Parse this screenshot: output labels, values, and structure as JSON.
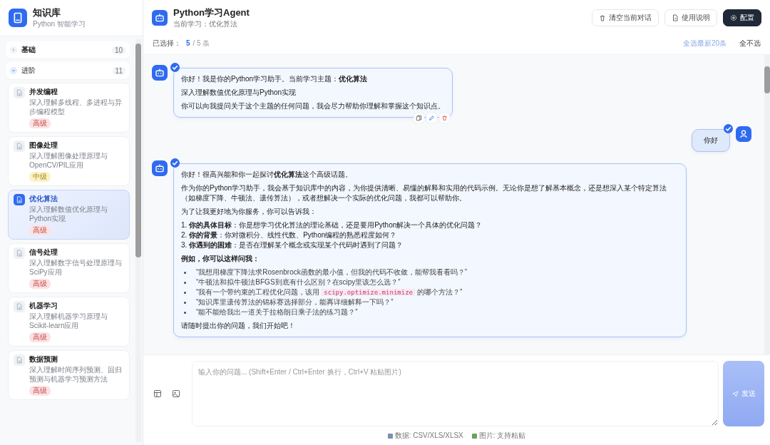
{
  "sidebar": {
    "title": "知识库",
    "subtitle": "Python 智能学习",
    "groups": [
      {
        "label": "基础",
        "count": "10",
        "expanded": false
      },
      {
        "label": "进阶",
        "count": "11",
        "expanded": true,
        "items": [
          {
            "title": "并发编程",
            "desc": "深入理解多线程、多进程与异步编程模型",
            "tag": {
              "label": "高级",
              "kind": "advanced"
            },
            "selected": false
          },
          {
            "title": "图像处理",
            "desc": "深入理解图像处理原理与OpenCV/PIL应用",
            "tag": {
              "label": "中级",
              "kind": "intermediate"
            },
            "selected": false
          },
          {
            "title": "优化算法",
            "desc": "深入理解数值优化原理与Python实现",
            "tag": {
              "label": "高级",
              "kind": "advanced"
            },
            "selected": true
          },
          {
            "title": "信号处理",
            "desc": "深入理解数字信号处理原理与SciPy应用",
            "tag": {
              "label": "高级",
              "kind": "advanced"
            },
            "selected": false
          },
          {
            "title": "机器学习",
            "desc": "深入理解机器学习原理与Scikit-learn应用",
            "tag": {
              "label": "高级",
              "kind": "advanced"
            },
            "selected": false
          },
          {
            "title": "数据预测",
            "desc": "深入理解时间序列预测、回归预测与机器学习预测方法",
            "tag": {
              "label": "高级",
              "kind": "advanced"
            },
            "selected": false
          }
        ]
      }
    ]
  },
  "header": {
    "title": "Python学习Agent",
    "subtitle": "当前学习：优化算法",
    "buttons": [
      {
        "label": "清空当前对话",
        "kind": "clear"
      },
      {
        "label": "使用说明",
        "kind": "help"
      },
      {
        "label": "配置",
        "kind": "config"
      }
    ]
  },
  "selection": {
    "label": "已选择：",
    "count": "5",
    "total": "/ 5 条",
    "select_latest": "全选最新20条",
    "select_none": "全不选"
  },
  "messages": [
    {
      "kind": "bot",
      "checked": true,
      "actions": true,
      "blocks": [
        {
          "kind": "p",
          "text": "你好！我是你的Python学习助手。当前学习主题：**优化算法**"
        },
        {
          "kind": "p",
          "text": "深入理解数值优化原理与Python实现"
        },
        {
          "kind": "p",
          "text": "你可以向我提问关于这个主题的任何问题，我会尽力帮助你理解和掌握这个知识点。"
        }
      ]
    },
    {
      "kind": "user",
      "checked": true,
      "actions": false,
      "blocks": [
        {
          "kind": "p",
          "text": "你好"
        }
      ]
    },
    {
      "kind": "bot",
      "checked": true,
      "actions": false,
      "blocks": [
        {
          "kind": "p",
          "text": "你好！很高兴能和你一起探讨**优化算法**这个高级话题。"
        },
        {
          "kind": "p",
          "text": "作为你的Python学习助手，我会基于知识库中的内容，为你提供清晰、易懂的解释和实用的代码示例。无论你是想了解基本概念，还是想深入某个特定算法（如梯度下降、牛顿法、遗传算法），或者想解决一个实际的优化问题，我都可以帮助你。"
        },
        {
          "kind": "p",
          "text": "为了让我更好地为你服务，你可以告诉我："
        },
        {
          "kind": "ol",
          "items": [
            "1. **你的具体目标**：你是想学习优化算法的理论基础，还是要用Python解决一个具体的优化问题？",
            "2. **你的背景**：你对微积分、线性代数、Python编程的熟悉程度如何？",
            "3. **你遇到的困难**：是否在理解某个概念或实现某个代码时遇到了问题？"
          ]
        },
        {
          "kind": "h",
          "text": "例如，你可以这样问我："
        },
        {
          "kind": "ul",
          "items": [
            [
              {
                "kind": "text",
                "text": "“我想用梯度下降法求Rosenbrock函数的最小值，但我的代码不收敛，能帮我看看吗？”"
              }
            ],
            [
              {
                "kind": "text",
                "text": "“牛顿法和拟牛顿法BFGS到底有什么区别？在scipy里该怎么选？”"
              }
            ],
            [
              {
                "kind": "text",
                "text": "“我有一个带约束的工程优化问题，该用"
              },
              {
                "kind": "code",
                "text": "scipy.optimize.minimize"
              },
              {
                "kind": "text",
                "text": "的哪个方法？”"
              }
            ],
            [
              {
                "kind": "text",
                "text": "“知识库里遗传算法的锦标赛选择部分，能再详细解释一下吗？”"
              }
            ],
            [
              {
                "kind": "text",
                "text": "“能不能给我出一道关于拉格朗日乘子法的练习题？”"
              }
            ]
          ]
        },
        {
          "kind": "p",
          "text": "请随时提出你的问题，我们开始吧！"
        }
      ]
    }
  ],
  "input": {
    "placeholder": "输入你的问题... (Shift+Enter / Ctrl+Enter 换行，Ctrl+V 粘贴图片)",
    "send": "发送",
    "hints": [
      {
        "kind": "data",
        "text": "数据: CSV/XLS/XLSX"
      },
      {
        "kind": "image",
        "text": "图片: 支持粘贴"
      }
    ]
  }
}
